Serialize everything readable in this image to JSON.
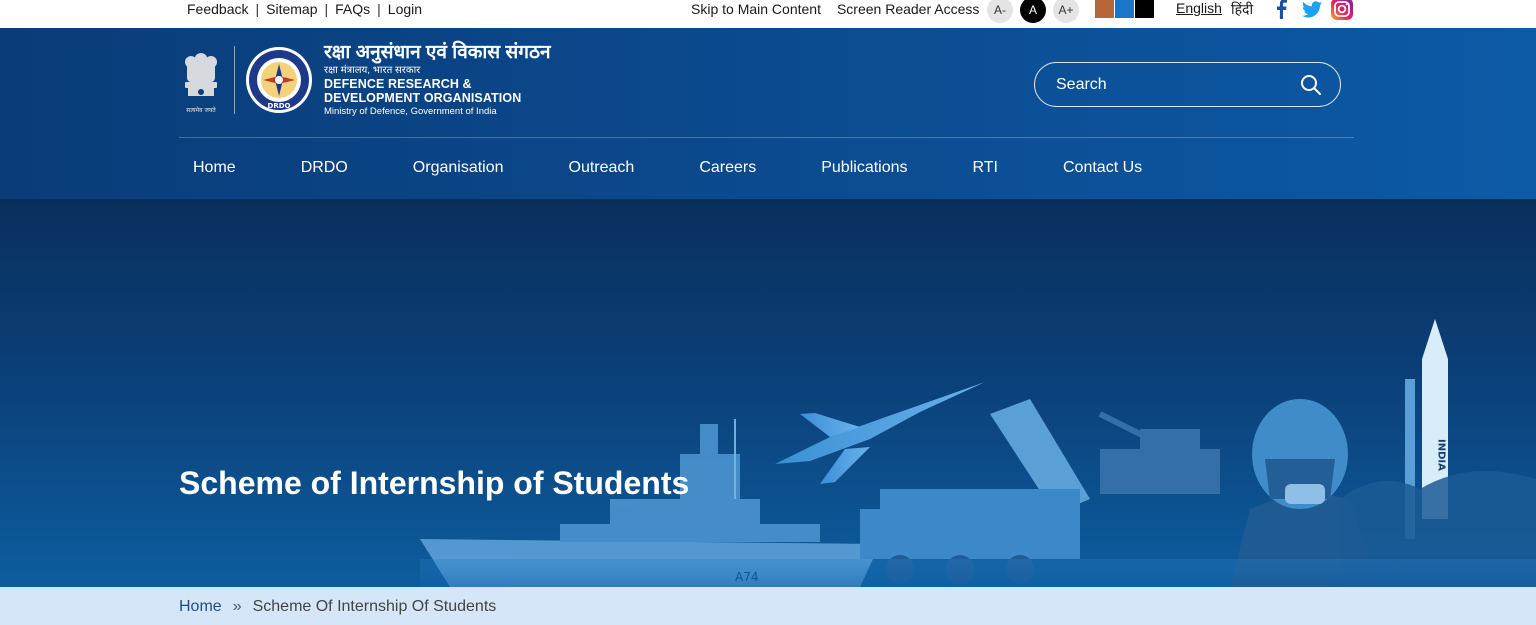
{
  "topbar": {
    "links": [
      "Feedback",
      "Sitemap",
      "FAQs",
      "Login"
    ],
    "skip_link": "Skip to Main Content",
    "screen_reader": "Screen Reader Access",
    "font_decrease": "A-",
    "font_normal": "A",
    "font_increase": "A+",
    "theme_colors": [
      "#b5673a",
      "#1976c8",
      "#000000"
    ],
    "lang_english": "English",
    "lang_hindi": "हिंदी",
    "social_icons": [
      "facebook-icon",
      "twitter-icon",
      "instagram-icon"
    ]
  },
  "header": {
    "emblem_motto": "सत्यमेव जयते",
    "seal_text": "DRDO",
    "org_name_hindi": "रक्षा अनुसंधान एवं विकास संगठन",
    "ministry_hindi": "रक्षा मंत्रालय, भारत सरकार",
    "org_name_en_line1": "DEFENCE RESEARCH &",
    "org_name_en_line2": "DEVELOPMENT ORGANISATION",
    "ministry_en": "Ministry of Defence, Government of India",
    "search_placeholder": "Search",
    "brand_color": "#0b4a8f"
  },
  "nav": {
    "items": [
      "Home",
      "DRDO",
      "Organisation",
      "Outreach",
      "Careers",
      "Publications",
      "RTI",
      "Contact Us"
    ]
  },
  "hero": {
    "title": "Scheme of Internship of Students",
    "missile_text": "INDIA",
    "ship_number": "A74"
  },
  "breadcrumb": {
    "home": "Home",
    "separator": "»",
    "current": "Scheme Of Internship Of Students"
  }
}
